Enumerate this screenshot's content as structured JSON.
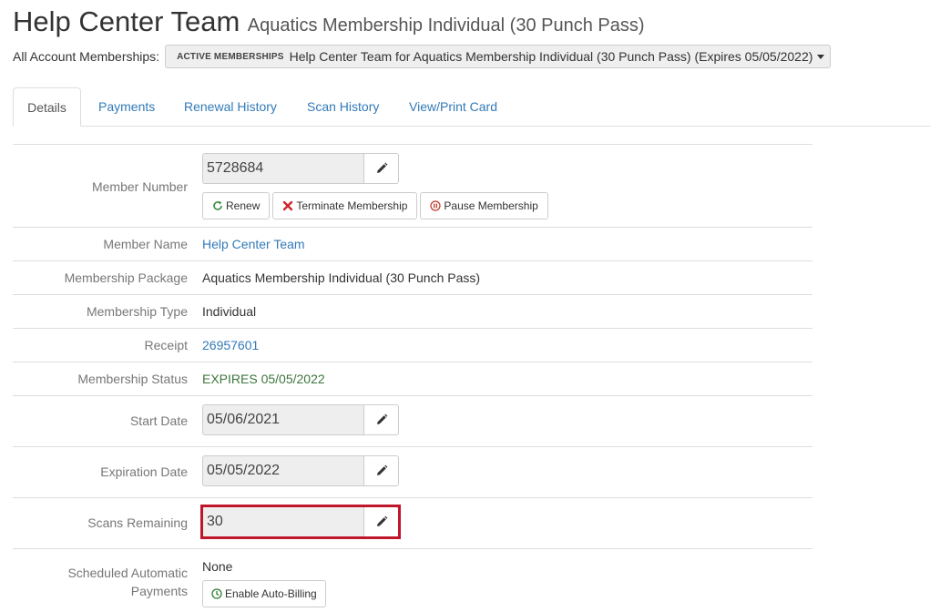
{
  "header": {
    "member_name": "Help Center Team",
    "package_subtitle": "Aquatics Membership Individual (30 Punch Pass)"
  },
  "account": {
    "label": "All Account Memberships:",
    "badge": "ACTIVE MEMBERSHIPS",
    "selected": "Help Center Team for Aquatics Membership Individual (30 Punch Pass) (Expires 05/05/2022)"
  },
  "tabs": [
    {
      "label": "Details",
      "active": true
    },
    {
      "label": "Payments"
    },
    {
      "label": "Renewal History"
    },
    {
      "label": "Scan History"
    },
    {
      "label": "View/Print Card"
    }
  ],
  "details": {
    "member_number": {
      "label": "Member Number",
      "value": "5728684"
    },
    "actions": {
      "renew": "Renew",
      "terminate": "Terminate Membership",
      "pause": "Pause Membership"
    },
    "member_name": {
      "label": "Member Name",
      "value": "Help Center Team"
    },
    "package": {
      "label": "Membership Package",
      "value": "Aquatics Membership Individual (30 Punch Pass)"
    },
    "type": {
      "label": "Membership Type",
      "value": "Individual"
    },
    "receipt": {
      "label": "Receipt",
      "value": "26957601"
    },
    "status": {
      "label": "Membership Status",
      "value": "EXPIRES 05/05/2022"
    },
    "start_date": {
      "label": "Start Date",
      "value": "05/06/2021"
    },
    "expiration_date": {
      "label": "Expiration Date",
      "value": "05/05/2022"
    },
    "scans_remaining": {
      "label": "Scans Remaining",
      "value": "30"
    },
    "scheduled_payments": {
      "label_line1": "Scheduled Automatic",
      "label_line2": "Payments",
      "value": "None",
      "button": "Enable Auto-Billing"
    }
  },
  "colors": {
    "link": "#337ab7",
    "status_green": "#3c763d",
    "highlight": "#c0162c"
  },
  "icons": {
    "edit": "pencil-icon",
    "renew": "refresh-icon",
    "terminate": "x-icon",
    "pause": "pause-circle-icon",
    "auto_billing": "clock-icon"
  }
}
